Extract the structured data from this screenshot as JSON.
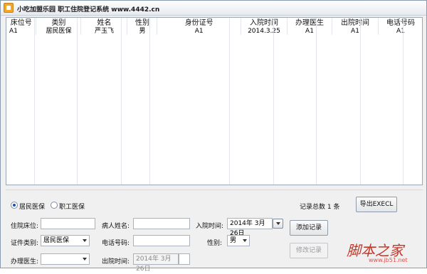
{
  "window": {
    "title": "小吃加盟乐园 职工住院登记系统   www.4442.cn"
  },
  "grid": {
    "columns": [
      "床位号",
      "类别",
      "姓名",
      "性别",
      "身份证号",
      "入院时间",
      "办理医生",
      "出院时间",
      "电话号码"
    ],
    "rows": [
      [
        "A1",
        "居民医保",
        "严玉飞",
        "男",
        "A1",
        "2014.3.25",
        "A1",
        "A1",
        "A1"
      ]
    ]
  },
  "filter": {
    "option1": "居民医保",
    "option2": "职工医保",
    "selected": "居民医保",
    "record_count": "记录总数 1 条",
    "export_label": "导出EXECL"
  },
  "form": {
    "bed_label": "住院床位:",
    "bed_value": "",
    "patient_label": "病人姓名:",
    "patient_value": "",
    "admit_label": "入院时间:",
    "admit_value": "2014年 3月26日",
    "add_label": "添加记录",
    "cert_label": "证件类别:",
    "cert_value": "居民医保",
    "phone_label": "电话号码:",
    "phone_value": "",
    "gender_label": "性别:",
    "gender_value": "男",
    "edit_label": "修改记录",
    "doctor_label": "办理医生:",
    "doctor_value": "",
    "discharge_label": "出院时间:",
    "discharge_value": "2014年  3月26日"
  },
  "watermark": {
    "main": "脚本之家",
    "sub": "www.jb51.net"
  }
}
